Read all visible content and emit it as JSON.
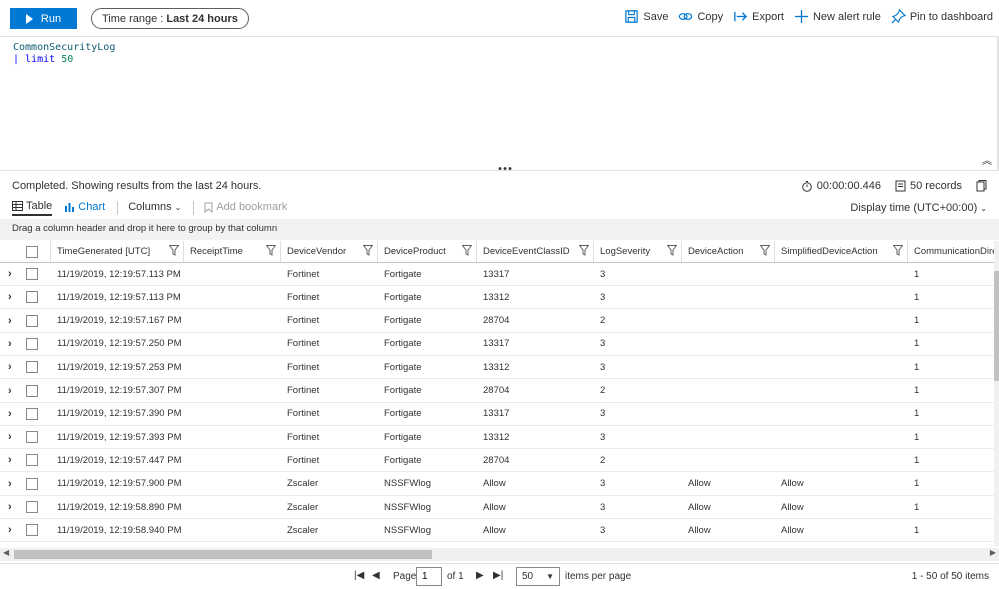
{
  "toolbar": {
    "run_label": "Run",
    "time_range_label": "Time range :",
    "time_range_value": "Last 24 hours",
    "actions": {
      "save": "Save",
      "copy": "Copy",
      "export": "Export",
      "new_alert": "New alert rule",
      "pin": "Pin to dashboard"
    }
  },
  "editor": {
    "line1": "CommonSecurityLog",
    "line2_pipe": "| ",
    "line2_kw": "limit",
    "line2_num": "50"
  },
  "status": {
    "text": "Completed. Showing results from the last 24 hours.",
    "duration": "00:00:00.446",
    "records": "50 records"
  },
  "tabs": {
    "table": "Table",
    "chart": "Chart",
    "columns": "Columns",
    "bookmark": "Add bookmark",
    "display_time": "Display time (UTC+00:00)"
  },
  "group_hint": "Drag a column header and drop it here to group by that column",
  "columns": [
    "TimeGenerated [UTC]",
    "ReceiptTime",
    "DeviceVendor",
    "DeviceProduct",
    "DeviceEventClassID",
    "LogSeverity",
    "DeviceAction",
    "SimplifiedDeviceAction",
    "CommunicationDirection"
  ],
  "rows": [
    [
      "11/19/2019, 12:19:57.113 PM",
      "",
      "Fortinet",
      "Fortigate",
      "13317",
      "3",
      "",
      "",
      "1"
    ],
    [
      "11/19/2019, 12:19:57.113 PM",
      "",
      "Fortinet",
      "Fortigate",
      "13312",
      "3",
      "",
      "",
      "1"
    ],
    [
      "11/19/2019, 12:19:57.167 PM",
      "",
      "Fortinet",
      "Fortigate",
      "28704",
      "2",
      "",
      "",
      "1"
    ],
    [
      "11/19/2019, 12:19:57.250 PM",
      "",
      "Fortinet",
      "Fortigate",
      "13317",
      "3",
      "",
      "",
      "1"
    ],
    [
      "11/19/2019, 12:19:57.253 PM",
      "",
      "Fortinet",
      "Fortigate",
      "13312",
      "3",
      "",
      "",
      "1"
    ],
    [
      "11/19/2019, 12:19:57.307 PM",
      "",
      "Fortinet",
      "Fortigate",
      "28704",
      "2",
      "",
      "",
      "1"
    ],
    [
      "11/19/2019, 12:19:57.390 PM",
      "",
      "Fortinet",
      "Fortigate",
      "13317",
      "3",
      "",
      "",
      "1"
    ],
    [
      "11/19/2019, 12:19:57.393 PM",
      "",
      "Fortinet",
      "Fortigate",
      "13312",
      "3",
      "",
      "",
      "1"
    ],
    [
      "11/19/2019, 12:19:57.447 PM",
      "",
      "Fortinet",
      "Fortigate",
      "28704",
      "2",
      "",
      "",
      "1"
    ],
    [
      "11/19/2019, 12:19:57.900 PM",
      "",
      "Zscaler",
      "NSSFWlog",
      "Allow",
      "3",
      "Allow",
      "Allow",
      "1"
    ],
    [
      "11/19/2019, 12:19:58.890 PM",
      "",
      "Zscaler",
      "NSSFWlog",
      "Allow",
      "3",
      "Allow",
      "Allow",
      "1"
    ],
    [
      "11/19/2019, 12:19:58.940 PM",
      "",
      "Zscaler",
      "NSSFWlog",
      "Allow",
      "3",
      "Allow",
      "Allow",
      "1"
    ]
  ],
  "pager": {
    "page_label": "Page",
    "page_value": "1",
    "of_label": "of 1",
    "page_size": "50",
    "per_page_label": "items per page",
    "count": "1 - 50 of 50 items"
  },
  "colors": {
    "accent": "#0078d4"
  }
}
